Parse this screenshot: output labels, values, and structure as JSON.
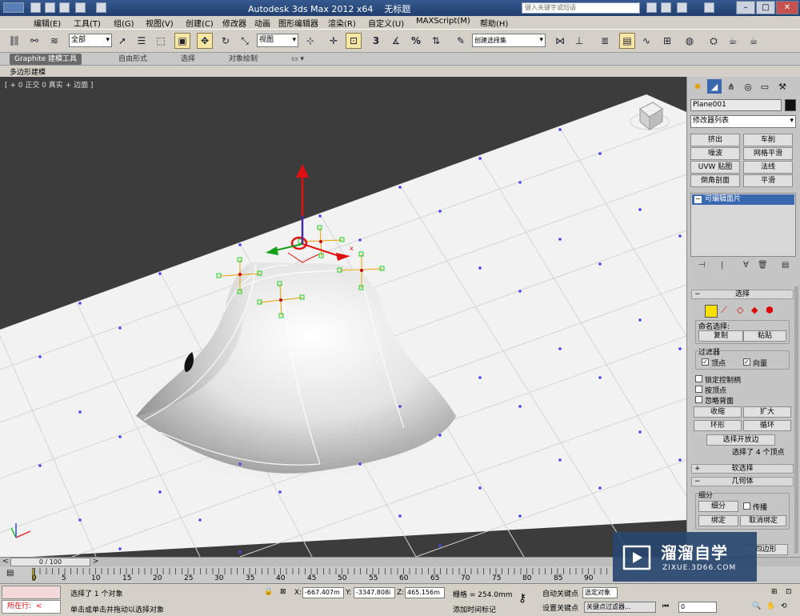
{
  "title_bar": {
    "app_title": "Autodesk 3ds Max  2012 x64",
    "file_title": "无标题",
    "search_placeholder": "键入关键字或短语"
  },
  "menu": [
    "编辑(E)",
    "工具(T)",
    "组(G)",
    "视图(V)",
    "创建(C)",
    "修改器",
    "动画",
    "图形编辑器",
    "渲染(R)",
    "自定义(U)",
    "MAXScript(M)",
    "帮助(H)"
  ],
  "toolbar": {
    "selection_filter": "全部",
    "reference_coord": "视图",
    "named_selection": "创建选择集",
    "snap_labels": [
      "3",
      "%"
    ]
  },
  "ribbon": {
    "tabs": [
      "Graphite 建模工具",
      "自由形式",
      "选择",
      "对象绘制"
    ],
    "active_sub": "多边形建模"
  },
  "viewport": {
    "label": "[ + 0 正交 0 真实 + 边面 ]",
    "gizmo_axis": "x"
  },
  "command_panel": {
    "object_name": "Plane001",
    "modifier_list": "修改器列表",
    "modifier_buttons": [
      "挤出",
      "车削",
      "噪波",
      "网格平滑",
      "UVW 贴图",
      "法线",
      "倒角剖面",
      "平滑"
    ],
    "stack_item": "可编辑面片",
    "selection": {
      "title": "选择",
      "named_sel_label": "命名选择:",
      "copy": "复制",
      "paste": "粘贴",
      "filter_label": "过滤器",
      "vertex": "顶点",
      "vector": "向量",
      "lock_handles": "锁定控制柄",
      "by_vertex": "按顶点",
      "ignore_backface": "忽略背面",
      "shrink": "收缩",
      "grow": "扩大",
      "ring": "环形",
      "loop": "循环",
      "select_open": "选择开放边",
      "status": "选择了 4 个顶点"
    },
    "soft_selection": "软选择",
    "geometry": {
      "title": "几何体",
      "subdivide_label": "细分",
      "subdivide": "细分",
      "propagate": "传播",
      "bind": "绑定",
      "unbind": "取消绑定",
      "quad": "四边形"
    }
  },
  "timeline": {
    "slider": "0 / 100",
    "ticks": [
      "0",
      "5",
      "10",
      "15",
      "20",
      "25",
      "30",
      "35",
      "40",
      "45",
      "50",
      "55",
      "60",
      "65",
      "70",
      "75",
      "80",
      "85",
      "90"
    ]
  },
  "status": {
    "current_label": "所在行:",
    "selected": "选择了 1 个对象",
    "hint": "单击或单击并拖动以选择对象",
    "x_label": "X:",
    "x": "-667.407m",
    "y_label": "Y:",
    "y": "-3347.808i",
    "z_label": "Z:",
    "z": "465.156m",
    "grid": "栅格 = 254.0mm",
    "auto_key": "自动关键点",
    "selected_set": "选定对象",
    "set_key": "设置关键点",
    "key_filters": "关键点过滤器...",
    "add_tag": "添加时间标记",
    "frame": "0"
  },
  "watermark": {
    "title": "溜溜自学",
    "url": "ZIXUE.3D66.COM"
  },
  "colors": {
    "accent_blue": "#3a68b0",
    "selection_yellow": "#f5e000",
    "gizmo_red": "#e01010"
  }
}
